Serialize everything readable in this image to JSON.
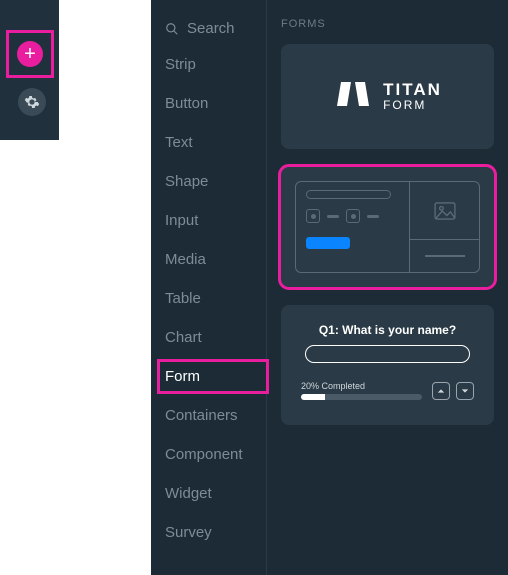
{
  "rail": {
    "add_label": "+"
  },
  "search": {
    "label": "Search"
  },
  "categories": [
    {
      "label": "Strip"
    },
    {
      "label": "Button"
    },
    {
      "label": "Text"
    },
    {
      "label": "Shape"
    },
    {
      "label": "Input"
    },
    {
      "label": "Media"
    },
    {
      "label": "Table"
    },
    {
      "label": "Chart"
    },
    {
      "label": "Form",
      "selected": true
    },
    {
      "label": "Containers"
    },
    {
      "label": "Component"
    },
    {
      "label": "Widget"
    },
    {
      "label": "Survey"
    }
  ],
  "section": {
    "title": "FORMS"
  },
  "titan": {
    "line1": "TITAN",
    "line2": "FORM"
  },
  "survey_preview": {
    "question": "Q1: What is your name?",
    "progress_label": "20% Completed",
    "progress_pct": 20
  },
  "colors": {
    "highlight": "#e91e9e",
    "accent_blue": "#0a84ff",
    "panel_bg": "#1c2b36",
    "card_bg": "#2a3a46"
  }
}
